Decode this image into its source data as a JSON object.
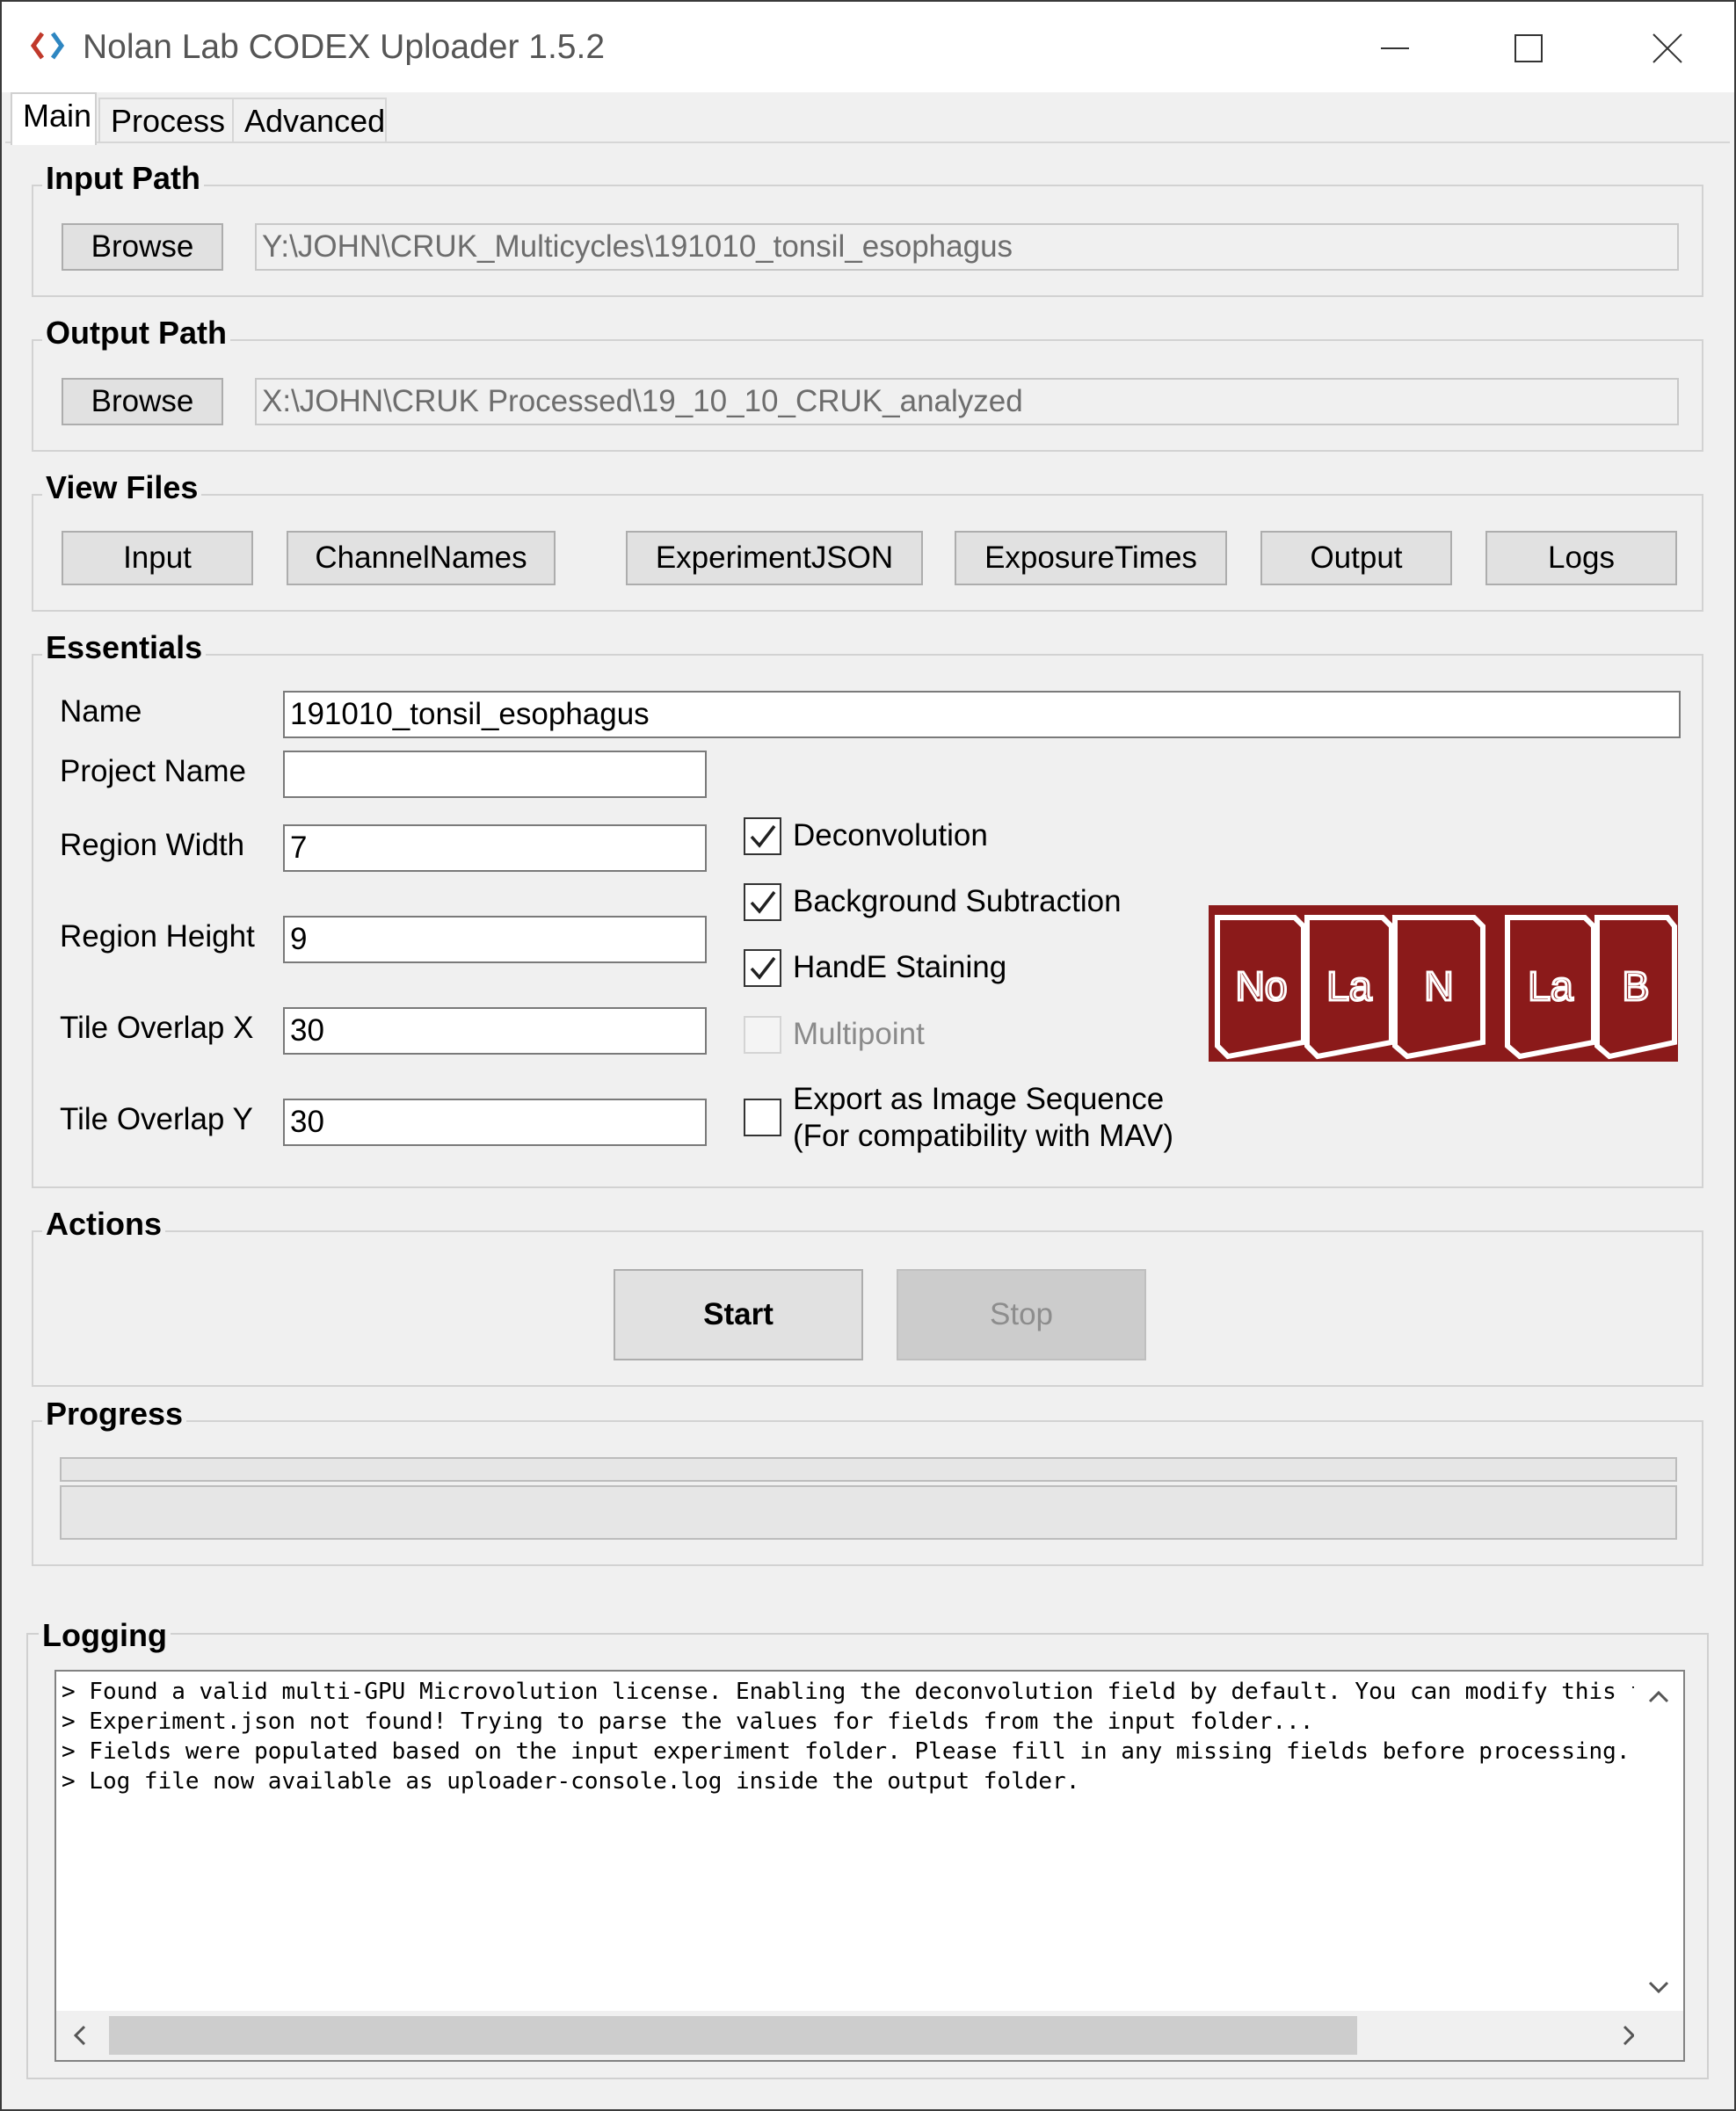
{
  "window": {
    "title": "Nolan Lab CODEX Uploader 1.5.2",
    "minimize": "—",
    "maximize": "☐",
    "close": "✕"
  },
  "tabs": [
    {
      "label": "Main",
      "active": true
    },
    {
      "label": "Process",
      "active": false
    },
    {
      "label": "Advanced",
      "active": false
    }
  ],
  "input_path": {
    "title": "Input Path",
    "browse_label": "Browse",
    "value": "Y:\\JOHN\\CRUK_Multicycles\\191010_tonsil_esophagus"
  },
  "output_path": {
    "title": "Output Path",
    "browse_label": "Browse",
    "value": "X:\\JOHN\\CRUK Processed\\19_10_10_CRUK_analyzed"
  },
  "view_files": {
    "title": "View Files",
    "buttons": [
      "Input",
      "ChannelNames",
      "ExperimentJSON",
      "ExposureTimes",
      "Output",
      "Logs"
    ]
  },
  "essentials": {
    "title": "Essentials",
    "name_label": "Name",
    "name_value": "191010_tonsil_esophagus",
    "project_label": "Project Name",
    "project_value": "",
    "region_width_label": "Region Width",
    "region_width_value": "7",
    "region_height_label": "Region Height",
    "region_height_value": "9",
    "tile_x_label": "Tile Overlap X",
    "tile_x_value": "30",
    "tile_y_label": "Tile Overlap Y",
    "tile_y_value": "30",
    "checkboxes": [
      {
        "label": "Deconvolution",
        "checked": true,
        "enabled": true
      },
      {
        "label": "Background Subtraction",
        "checked": true,
        "enabled": true
      },
      {
        "label": "HandE Staining",
        "checked": true,
        "enabled": true
      },
      {
        "label": "Multipoint",
        "checked": false,
        "enabled": false
      },
      {
        "label": "Export as Image Sequence",
        "label2": "(For compatibility with MAV)",
        "checked": false,
        "enabled": true
      }
    ],
    "logo_tiles": [
      "No",
      "La",
      "N",
      "La",
      "B"
    ]
  },
  "actions": {
    "title": "Actions",
    "start_label": "Start",
    "stop_label": "Stop"
  },
  "progress": {
    "title": "Progress",
    "value": 0
  },
  "logging": {
    "title": "Logging",
    "lines": [
      "> Found a valid multi-GPU Microvolution license. Enabling the deconvolution field by default. You can modify this f",
      "> Experiment.json not found! Trying to parse the values for fields from the input folder...",
      "> Fields were populated based on the input experiment folder. Please fill in any missing fields before processing..",
      "> Log file now available as uploader-console.log inside the output folder."
    ]
  },
  "colors": {
    "logo_red": "#8b1a1a",
    "window_bg": "#f0f0f0",
    "button_bg": "#e1e1e1"
  }
}
